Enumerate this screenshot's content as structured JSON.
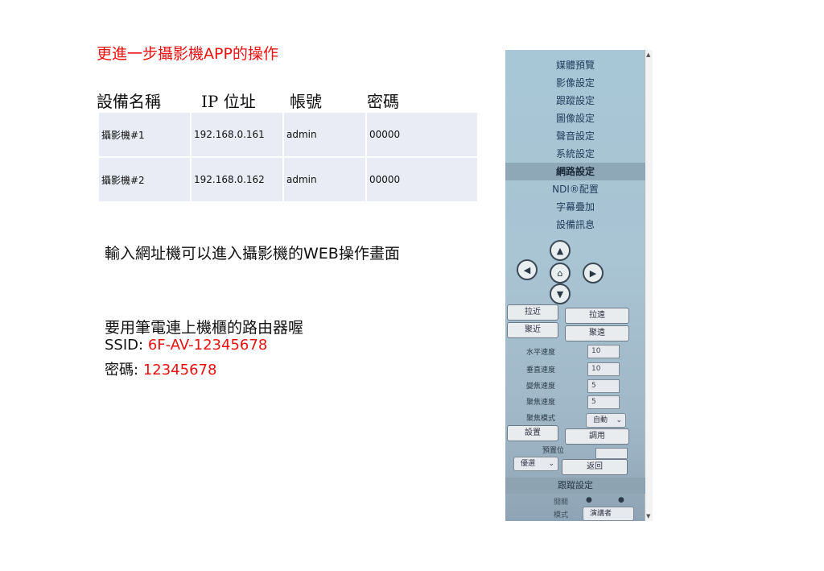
{
  "title": "更進一步攝影機APP的操作",
  "table": {
    "headers": [
      "設備名稱",
      "IP 位址",
      "帳號",
      "密碼"
    ],
    "rows": [
      [
        "攝影機#1",
        "192.168.0.161",
        "admin",
        "00000"
      ],
      [
        "攝影機#2",
        "192.168.0.162",
        "admin",
        "00000"
      ]
    ]
  },
  "note": "輸入網址機可以進入攝影機的WEB操作畫面",
  "router": {
    "heading": "要用筆電連上機櫃的路由器喔",
    "ssid_label": "SSID:",
    "ssid_value": "6F-AV-12345678",
    "password_label": "密碼:",
    "password_value": "12345678"
  },
  "camera_ui": {
    "menu": [
      "媒體預覽",
      "影像設定",
      "跟蹤設定",
      "圖像設定",
      "聲音設定",
      "系統設定",
      "網路設定",
      "NDI®配置",
      "字幕疊加",
      "設備訊息"
    ],
    "active_menu": "網路設定",
    "zoom_in": "拉近",
    "zoom_out": "拉遠",
    "focus_near": "聚近",
    "focus_far": "聚遠",
    "pan_speed_label": "水平速度",
    "pan_speed": "10",
    "tilt_speed_label": "垂直速度",
    "tilt_speed": "10",
    "zoom_speed_label": "變焦速度",
    "zoom_speed": "5",
    "focus_speed_label": "聚焦速度",
    "focus_speed": "5",
    "focus_mode_label": "聚焦模式",
    "focus_mode": "自動",
    "set_button": "設置",
    "call_button": "調用",
    "preset_label": "預置位",
    "preset_select": "優選",
    "back_button": "返回",
    "tracking_section": "跟蹤設定",
    "switch_label": "開關",
    "mode_label": "模式",
    "mode_value": "演講者"
  },
  "colors": {
    "title": "#e8110f",
    "table_cell": "#e9ebf5",
    "panel_bg": "#a7c6d6"
  }
}
